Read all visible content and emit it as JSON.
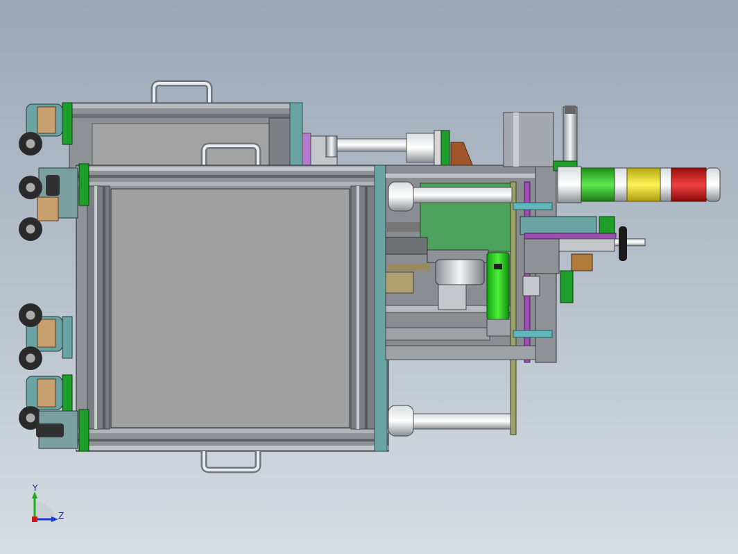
{
  "axis": {
    "y_label": "Y",
    "z_label": "Z"
  },
  "colors": {
    "background_top": "#9aa8b8",
    "background_bottom": "#d7dde3",
    "frame": "#8e9296",
    "panel": "#9a9a9a",
    "accent_green": "#1e9e2a",
    "accent_cyan": "#5fa6a8",
    "signal_green": "#2fbf2a",
    "signal_yellow": "#e6d81e",
    "signal_red": "#d41a1a",
    "rod_purple": "#9a4fb0",
    "motor_green": "#1ecf1a"
  }
}
